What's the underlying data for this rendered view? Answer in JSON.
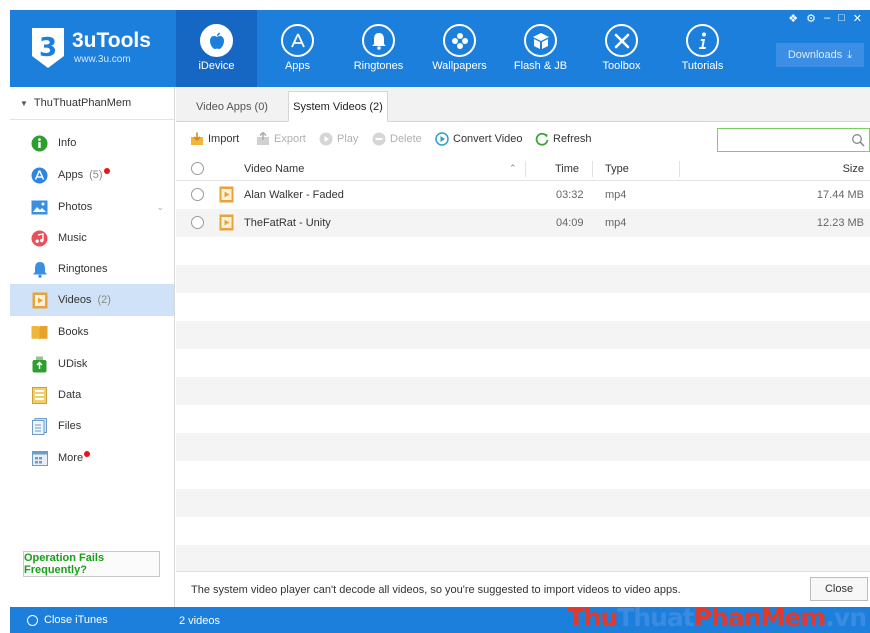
{
  "app": {
    "title": "3uTools",
    "url": "www.3u.com",
    "accent": "#1d7fdc",
    "nav": [
      {
        "label": "iDevice",
        "icon": "apple-icon",
        "active": true
      },
      {
        "label": "Apps",
        "icon": "app-store-icon"
      },
      {
        "label": "Ringtones",
        "icon": "bell-icon"
      },
      {
        "label": "Wallpapers",
        "icon": "flower-icon"
      },
      {
        "label": "Flash & JB",
        "icon": "box-icon"
      },
      {
        "label": "Toolbox",
        "icon": "tools-icon"
      },
      {
        "label": "Tutorials",
        "icon": "info-icon"
      }
    ],
    "downloads": "Downloads"
  },
  "sidebar": {
    "device": "ThuThuatPhanMem",
    "items": [
      {
        "label": "Info",
        "icon": "info-circle-icon"
      },
      {
        "label": "Apps",
        "count": "(5)",
        "dot": true,
        "icon": "apps-icon"
      },
      {
        "label": "Photos",
        "icon": "photos-icon"
      },
      {
        "label": "Music",
        "icon": "music-icon"
      },
      {
        "label": "Ringtones",
        "icon": "bell-icon"
      },
      {
        "label": "Videos",
        "count": "(2)",
        "active": true,
        "icon": "video-icon"
      },
      {
        "label": "Books",
        "icon": "book-icon"
      },
      {
        "label": "UDisk",
        "icon": "udisk-icon"
      },
      {
        "label": "Data",
        "icon": "data-icon"
      },
      {
        "label": "Files",
        "icon": "files-icon"
      },
      {
        "label": "More",
        "dot": true,
        "icon": "more-icon"
      }
    ],
    "operation_fails": "Operation Fails Frequently?"
  },
  "tabs": [
    {
      "label": "Video Apps (0)"
    },
    {
      "label": "System Videos (2)",
      "active": true
    }
  ],
  "toolbar": {
    "import": "Import",
    "export": "Export",
    "play": "Play",
    "delete": "Delete",
    "convert": "Convert Video",
    "refresh": "Refresh",
    "search_placeholder": ""
  },
  "table": {
    "columns": {
      "name": "Video Name",
      "time": "Time",
      "type": "Type",
      "size": "Size"
    },
    "rows": [
      {
        "name": "Alan Walker - Faded",
        "time": "03:32",
        "type": "mp4",
        "size": "17.44 MB"
      },
      {
        "name": "TheFatRat - Unity",
        "time": "04:09",
        "type": "mp4",
        "size": "12.23 MB"
      }
    ]
  },
  "footer": {
    "message": "The system video player can't decode all videos, so you're suggested to import videos to video apps.",
    "close": "Close"
  },
  "status": {
    "close_itunes": "Close iTunes",
    "count": "2 videos"
  },
  "watermark": {
    "part1": "Thu",
    "part2": "Thuat",
    "part3": "PhanMem",
    "part4": ".vn"
  }
}
